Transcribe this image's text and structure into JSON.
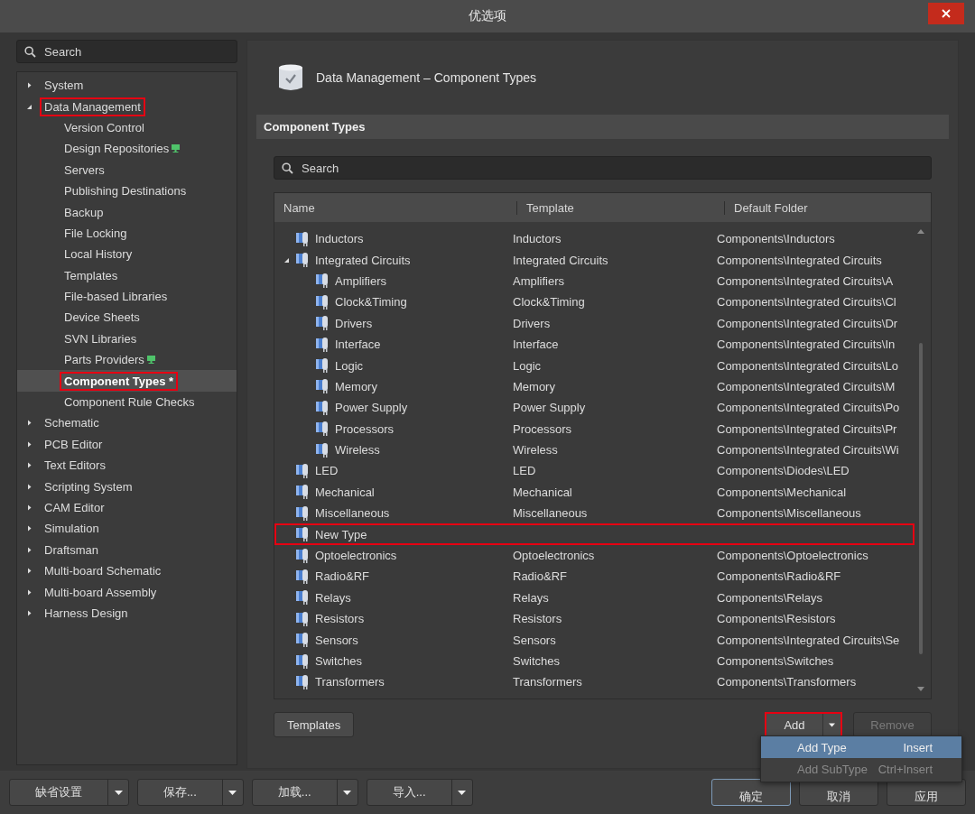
{
  "window": {
    "title": "优选项"
  },
  "sidebar": {
    "search": {
      "placeholder": "Search"
    },
    "items": [
      {
        "label": "System",
        "expanded": false,
        "selected": false,
        "highlighted": false
      },
      {
        "label": "Data Management",
        "expanded": true,
        "selected": false,
        "highlighted": true,
        "children": [
          {
            "label": "Version Control",
            "selected": false,
            "highlighted": false
          },
          {
            "label": "Design Repositories",
            "selected": false,
            "highlighted": false,
            "badge": true
          },
          {
            "label": "Servers",
            "selected": false,
            "highlighted": false
          },
          {
            "label": "Publishing Destinations",
            "selected": false,
            "highlighted": false
          },
          {
            "label": "Backup",
            "selected": false,
            "highlighted": false
          },
          {
            "label": "File Locking",
            "selected": false,
            "highlighted": false
          },
          {
            "label": "Local History",
            "selected": false,
            "highlighted": false
          },
          {
            "label": "Templates",
            "selected": false,
            "highlighted": false
          },
          {
            "label": "File-based Libraries",
            "selected": false,
            "highlighted": false
          },
          {
            "label": "Device Sheets",
            "selected": false,
            "highlighted": false
          },
          {
            "label": "SVN Libraries",
            "selected": false,
            "highlighted": false
          },
          {
            "label": "Parts Providers",
            "selected": false,
            "highlighted": false,
            "badge": true
          },
          {
            "label": "Component Types *",
            "selected": true,
            "highlighted": true
          },
          {
            "label": "Component Rule Checks",
            "selected": false,
            "highlighted": false
          }
        ]
      },
      {
        "label": "Schematic",
        "expanded": false,
        "selected": false,
        "highlighted": false
      },
      {
        "label": "PCB Editor",
        "expanded": false,
        "selected": false,
        "highlighted": false
      },
      {
        "label": "Text Editors",
        "expanded": false,
        "selected": false,
        "highlighted": false
      },
      {
        "label": "Scripting System",
        "expanded": false,
        "selected": false,
        "highlighted": false
      },
      {
        "label": "CAM Editor",
        "expanded": false,
        "selected": false,
        "highlighted": false
      },
      {
        "label": "Simulation",
        "expanded": false,
        "selected": false,
        "highlighted": false
      },
      {
        "label": "Draftsman",
        "expanded": false,
        "selected": false,
        "highlighted": false
      },
      {
        "label": "Multi-board Schematic",
        "expanded": false,
        "selected": false,
        "highlighted": false
      },
      {
        "label": "Multi-board Assembly",
        "expanded": false,
        "selected": false,
        "highlighted": false
      },
      {
        "label": "Harness Design",
        "expanded": false,
        "selected": false,
        "highlighted": false
      }
    ]
  },
  "page": {
    "title": "Data Management – Component Types",
    "section": "Component Types",
    "search": {
      "placeholder": "Search"
    }
  },
  "table": {
    "columns": [
      "Name",
      "Template",
      "Default Folder"
    ],
    "rows": [
      {
        "name": "Inductors",
        "template": "Inductors",
        "folder": "Components\\Inductors",
        "highlighted": false
      },
      {
        "name": "Integrated Circuits",
        "template": "Integrated Circuits",
        "folder": "Components\\Integrated Circuits",
        "highlighted": false,
        "expanded": true,
        "children": [
          {
            "name": "Amplifiers",
            "template": "Amplifiers",
            "folder": "Components\\Integrated Circuits\\A",
            "highlighted": false
          },
          {
            "name": "Clock&Timing",
            "template": "Clock&Timing",
            "folder": "Components\\Integrated Circuits\\Cl",
            "highlighted": false
          },
          {
            "name": "Drivers",
            "template": "Drivers",
            "folder": "Components\\Integrated Circuits\\Dr",
            "highlighted": false
          },
          {
            "name": "Interface",
            "template": "Interface",
            "folder": "Components\\Integrated Circuits\\In",
            "highlighted": false
          },
          {
            "name": "Logic",
            "template": "Logic",
            "folder": "Components\\Integrated Circuits\\Lo",
            "highlighted": false
          },
          {
            "name": "Memory",
            "template": "Memory",
            "folder": "Components\\Integrated Circuits\\M",
            "highlighted": false
          },
          {
            "name": "Power Supply",
            "template": "Power Supply",
            "folder": "Components\\Integrated Circuits\\Po",
            "highlighted": false
          },
          {
            "name": "Processors",
            "template": "Processors",
            "folder": "Components\\Integrated Circuits\\Pr",
            "highlighted": false
          },
          {
            "name": "Wireless",
            "template": "Wireless",
            "folder": "Components\\Integrated Circuits\\Wi",
            "highlighted": false
          }
        ]
      },
      {
        "name": "LED",
        "template": "LED",
        "folder": "Components\\Diodes\\LED",
        "highlighted": false
      },
      {
        "name": "Mechanical",
        "template": "Mechanical",
        "folder": "Components\\Mechanical",
        "highlighted": false
      },
      {
        "name": "Miscellaneous",
        "template": "Miscellaneous",
        "folder": "Components\\Miscellaneous",
        "highlighted": false
      },
      {
        "name": "New Type",
        "highlighted": true
      },
      {
        "name": "Optoelectronics",
        "template": "Optoelectronics",
        "folder": "Components\\Optoelectronics",
        "highlighted": false
      },
      {
        "name": "Radio&RF",
        "template": "Radio&RF",
        "folder": "Components\\Radio&RF",
        "highlighted": false
      },
      {
        "name": "Relays",
        "template": "Relays",
        "folder": "Components\\Relays",
        "highlighted": false
      },
      {
        "name": "Resistors",
        "template": "Resistors",
        "folder": "Components\\Resistors",
        "highlighted": false
      },
      {
        "name": "Sensors",
        "template": "Sensors",
        "folder": "Components\\Integrated Circuits\\Se",
        "highlighted": false
      },
      {
        "name": "Switches",
        "template": "Switches",
        "folder": "Components\\Switches",
        "highlighted": false
      },
      {
        "name": "Transformers",
        "template": "Transformers",
        "folder": "Components\\Transformers",
        "highlighted": false
      }
    ]
  },
  "buttons": {
    "templates": {
      "label": "Templates"
    },
    "add": {
      "label": "Add",
      "highlighted": true
    },
    "remove": {
      "label": "Remove",
      "disabled": true
    }
  },
  "menu": [
    {
      "label": "Add Type",
      "shortcut": "Insert",
      "selected": true,
      "disabled": false
    },
    {
      "label": "Add SubType",
      "shortcut": "Ctrl+Insert",
      "selected": false,
      "disabled": true
    }
  ],
  "footer": {
    "left": [
      {
        "label": "缺省设置"
      },
      {
        "label": "保存..."
      },
      {
        "label": "加载..."
      },
      {
        "label": "导入..."
      }
    ],
    "right": [
      {
        "label": "确定",
        "default": true
      },
      {
        "label": "取消",
        "default": false
      },
      {
        "label": "应用",
        "default": false
      }
    ]
  }
}
